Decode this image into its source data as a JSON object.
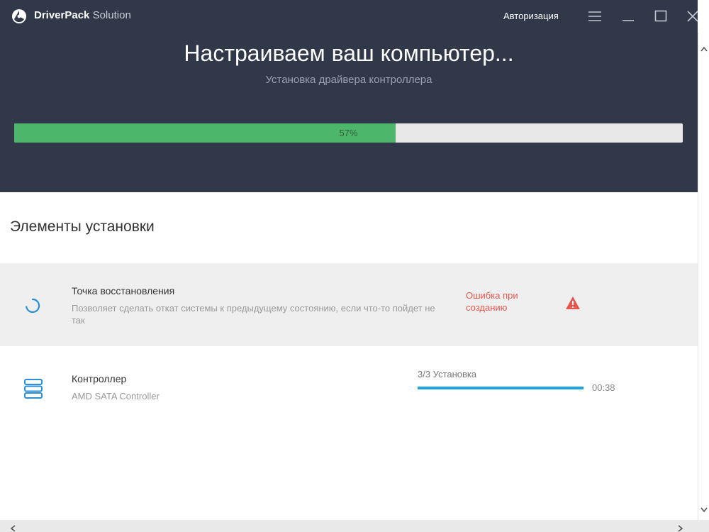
{
  "window": {
    "brand_bold": "DriverPack",
    "brand_light": "Solution",
    "auth_label": "Авторизация",
    "icons": [
      "driverpack-logo-icon",
      "hamburger-menu-icon",
      "minimize-icon",
      "maximize-icon",
      "close-icon"
    ]
  },
  "header": {
    "title": "Настраиваем ваш компьютер...",
    "subtitle": "Установка драйвера контроллера",
    "progress_text": "57%",
    "progress_value": 0.57,
    "progress_color": "#4cb66a",
    "background_color": "#303849"
  },
  "content": {
    "section_title": "Элементы установки",
    "items": [
      {
        "name": "Точка восстановления",
        "description": "Позволяет сделать откат системы к предыдущему состоянию, если что-то пойдет не так",
        "status_text": "Ошибка при созданию",
        "status_color": "#e5574e",
        "icon": "loading-spinner-icon",
        "status_icon": "warning-icon"
      },
      {
        "name": "Контроллер",
        "description": "AMD SATA Controller",
        "step_label": "3/3 Установка",
        "step_progress": 1.0,
        "step_color": "#1fa5de",
        "time": "00:38",
        "icon": "server-stack-icon"
      }
    ]
  }
}
